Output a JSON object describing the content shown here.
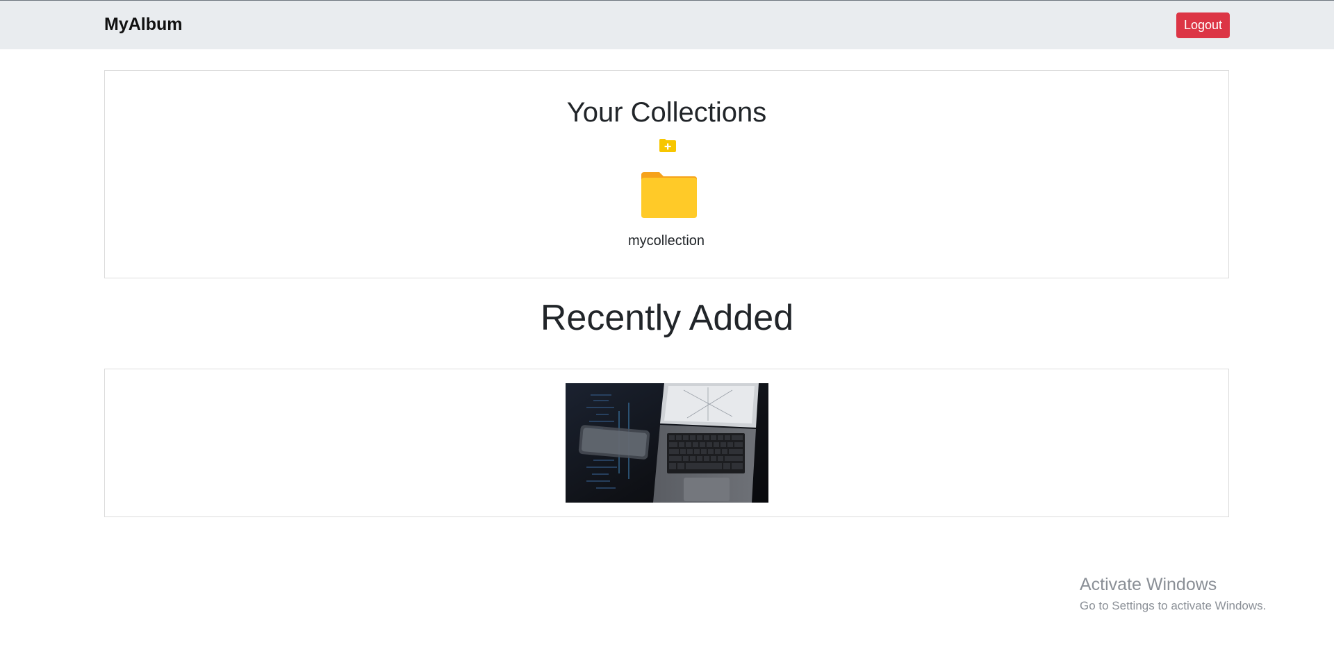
{
  "navbar": {
    "brand": "MyAlbum",
    "logout_label": "Logout",
    "logout_color": "#dc3545",
    "background": "#e9ecef"
  },
  "collections": {
    "title": "Your Collections",
    "add_icon": "folder-plus-icon",
    "folder_color": "#ffca28",
    "items": [
      {
        "name": "mycollection",
        "icon": "folder-icon"
      }
    ]
  },
  "recent": {
    "title": "Recently Added",
    "items": [
      {
        "thumbnail": "laptop-photo"
      }
    ]
  },
  "watermark": {
    "title": "Activate Windows",
    "subtitle": "Go to Settings to activate Windows."
  }
}
